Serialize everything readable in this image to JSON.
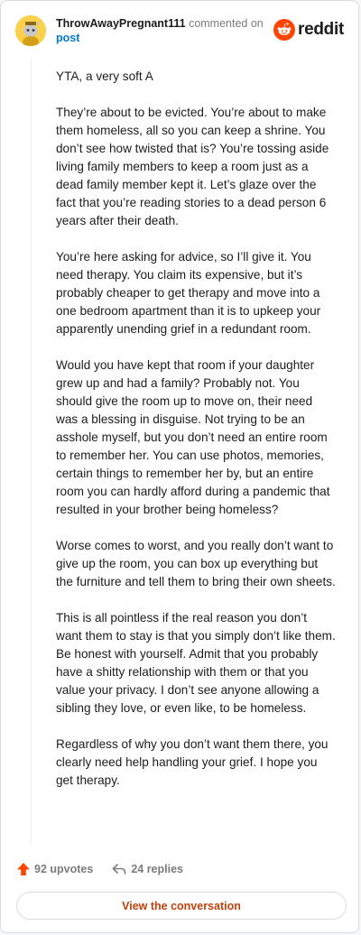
{
  "header": {
    "username": "ThrowAwayPregnant111",
    "action": "commented on",
    "target": "post",
    "brand": "reddit",
    "avatar_icon": "snoo-avatar-icon",
    "brand_color": "#ff4500"
  },
  "comment": {
    "paragraphs": [
      "YTA, a very soft A",
      "They’re about to be evicted. You’re about to make them homeless, all so you can keep a shrine. You don’t see how twisted that is? You’re tossing aside living family members to keep a room just as a dead family member kept it. Let’s glaze over the fact that you’re reading stories to a dead person 6 years after their death.",
      "You’re here asking for advice, so I’ll give it. You need therapy. You claim its expensive, but it’s probably cheaper to get therapy and move into a one bedroom apartment than it is to upkeep your apparently unending grief in a redundant room.",
      "Would you have kept that room if your daughter grew up and had a family? Probably not. You should give the room up to move on, their need was a blessing in disguise. Not trying to be an asshole myself, but you don’t need an entire room to remember her. You can use photos, memories, certain things to remember her by, but an entire room you can hardly afford during a pandemic that resulted in your brother being homeless?",
      "Worse comes to worst, and you really don’t want to give up the room, you can box up everything but the furniture and tell them to bring their own sheets.",
      "This is all pointless if the real reason you don’t want them to stay is that you simply don’t like them. Be honest with yourself. Admit that you probably have a shitty relationship with them or that you value your privacy. I don’t see anyone allowing a sibling they love, or even like, to be homeless.",
      "Regardless of why you don’t want them there, you clearly need help handling your grief. I hope you get therapy."
    ]
  },
  "footer": {
    "upvotes": "92 upvotes",
    "replies": "24 replies",
    "upvote_icon": "upvote-arrow-icon",
    "reply_icon": "reply-arrow-icon",
    "upvote_color": "#ff4500"
  },
  "cta": {
    "label": "View the conversation",
    "color": "#c2410c"
  }
}
